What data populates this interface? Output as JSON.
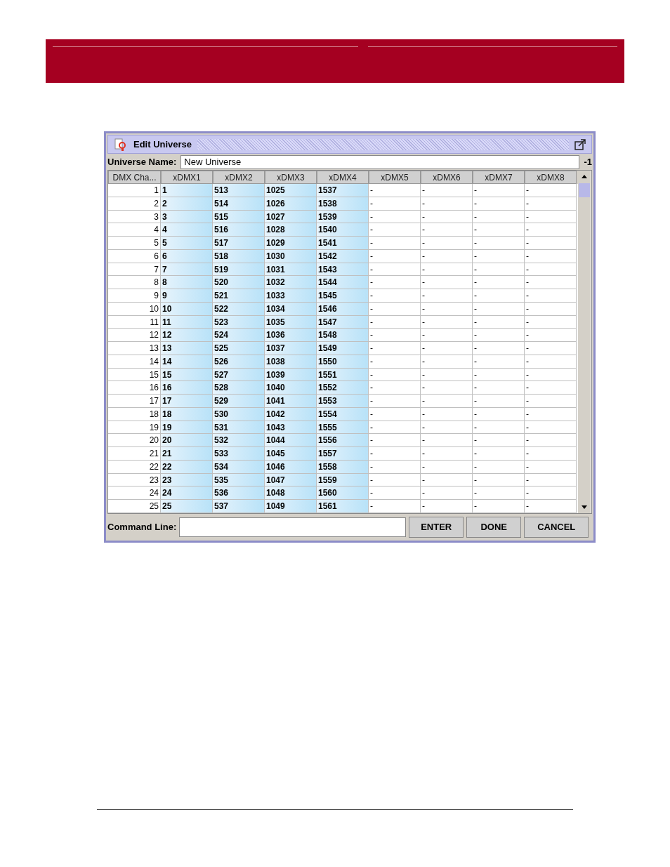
{
  "window": {
    "title": "Edit Universe"
  },
  "universe_name": {
    "label": "Universe Name:",
    "value": "New Universe",
    "suffix": "-1"
  },
  "table": {
    "columns": [
      {
        "label": "DMX Cha...",
        "highlighted": false
      },
      {
        "label": "xDMX1",
        "highlighted": true
      },
      {
        "label": "xDMX2",
        "highlighted": true
      },
      {
        "label": "xDMX3",
        "highlighted": true
      },
      {
        "label": "xDMX4",
        "highlighted": true
      },
      {
        "label": "xDMX5",
        "highlighted": false
      },
      {
        "label": "xDMX6",
        "highlighted": false
      },
      {
        "label": "xDMX7",
        "highlighted": false
      },
      {
        "label": "xDMX8",
        "highlighted": false
      }
    ],
    "rows": [
      [
        "1",
        "1",
        "513",
        "1025",
        "1537",
        "-",
        "-",
        "-",
        "-"
      ],
      [
        "2",
        "2",
        "514",
        "1026",
        "1538",
        "-",
        "-",
        "-",
        "-"
      ],
      [
        "3",
        "3",
        "515",
        "1027",
        "1539",
        "-",
        "-",
        "-",
        "-"
      ],
      [
        "4",
        "4",
        "516",
        "1028",
        "1540",
        "-",
        "-",
        "-",
        "-"
      ],
      [
        "5",
        "5",
        "517",
        "1029",
        "1541",
        "-",
        "-",
        "-",
        "-"
      ],
      [
        "6",
        "6",
        "518",
        "1030",
        "1542",
        "-",
        "-",
        "-",
        "-"
      ],
      [
        "7",
        "7",
        "519",
        "1031",
        "1543",
        "-",
        "-",
        "-",
        "-"
      ],
      [
        "8",
        "8",
        "520",
        "1032",
        "1544",
        "-",
        "-",
        "-",
        "-"
      ],
      [
        "9",
        "9",
        "521",
        "1033",
        "1545",
        "-",
        "-",
        "-",
        "-"
      ],
      [
        "10",
        "10",
        "522",
        "1034",
        "1546",
        "-",
        "-",
        "-",
        "-"
      ],
      [
        "11",
        "11",
        "523",
        "1035",
        "1547",
        "-",
        "-",
        "-",
        "-"
      ],
      [
        "12",
        "12",
        "524",
        "1036",
        "1548",
        "-",
        "-",
        "-",
        "-"
      ],
      [
        "13",
        "13",
        "525",
        "1037",
        "1549",
        "-",
        "-",
        "-",
        "-"
      ],
      [
        "14",
        "14",
        "526",
        "1038",
        "1550",
        "-",
        "-",
        "-",
        "-"
      ],
      [
        "15",
        "15",
        "527",
        "1039",
        "1551",
        "-",
        "-",
        "-",
        "-"
      ],
      [
        "16",
        "16",
        "528",
        "1040",
        "1552",
        "-",
        "-",
        "-",
        "-"
      ],
      [
        "17",
        "17",
        "529",
        "1041",
        "1553",
        "-",
        "-",
        "-",
        "-"
      ],
      [
        "18",
        "18",
        "530",
        "1042",
        "1554",
        "-",
        "-",
        "-",
        "-"
      ],
      [
        "19",
        "19",
        "531",
        "1043",
        "1555",
        "-",
        "-",
        "-",
        "-"
      ],
      [
        "20",
        "20",
        "532",
        "1044",
        "1556",
        "-",
        "-",
        "-",
        "-"
      ],
      [
        "21",
        "21",
        "533",
        "1045",
        "1557",
        "-",
        "-",
        "-",
        "-"
      ],
      [
        "22",
        "22",
        "534",
        "1046",
        "1558",
        "-",
        "-",
        "-",
        "-"
      ],
      [
        "23",
        "23",
        "535",
        "1047",
        "1559",
        "-",
        "-",
        "-",
        "-"
      ],
      [
        "24",
        "24",
        "536",
        "1048",
        "1560",
        "-",
        "-",
        "-",
        "-"
      ],
      [
        "25",
        "25",
        "537",
        "1049",
        "1561",
        "-",
        "-",
        "-",
        "-"
      ]
    ]
  },
  "command_line": {
    "label": "Command Line:"
  },
  "buttons": [
    "ENTER",
    "DONE",
    "CANCEL"
  ]
}
